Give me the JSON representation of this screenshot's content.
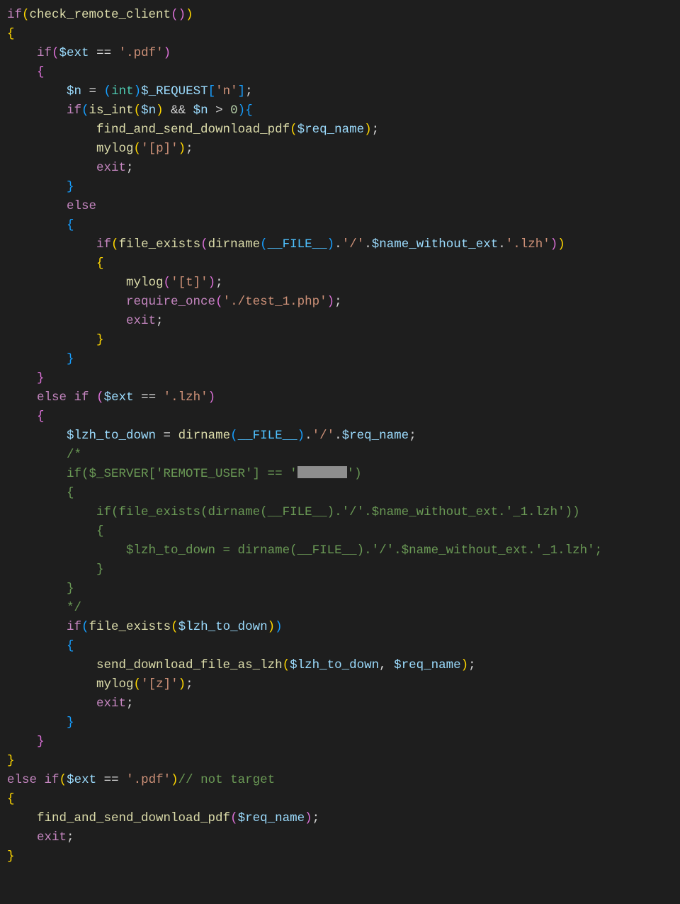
{
  "code": {
    "lines": [
      {
        "indent": 0,
        "seg": [
          {
            "c": "kw",
            "t": "if"
          },
          {
            "c": "br",
            "t": "("
          },
          {
            "c": "fn",
            "t": "check_remote_client"
          },
          {
            "c": "br2",
            "t": "("
          },
          {
            "c": "br2",
            "t": ")"
          },
          {
            "c": "br",
            "t": ")"
          }
        ]
      },
      {
        "indent": 0,
        "seg": [
          {
            "c": "br",
            "t": "{"
          }
        ]
      },
      {
        "indent": 1,
        "seg": [
          {
            "c": "kw",
            "t": "if"
          },
          {
            "c": "br2",
            "t": "("
          },
          {
            "c": "var",
            "t": "$ext"
          },
          {
            "c": "op",
            "t": " == "
          },
          {
            "c": "str",
            "t": "'.pdf'"
          },
          {
            "c": "br2",
            "t": ")"
          }
        ]
      },
      {
        "indent": 1,
        "seg": [
          {
            "c": "br2",
            "t": "{"
          }
        ]
      },
      {
        "indent": 2,
        "seg": [
          {
            "c": "var",
            "t": "$n"
          },
          {
            "c": "op",
            "t": " = "
          },
          {
            "c": "br3",
            "t": "("
          },
          {
            "c": "typ",
            "t": "int"
          },
          {
            "c": "br3",
            "t": ")"
          },
          {
            "c": "var",
            "t": "$_REQUEST"
          },
          {
            "c": "br3",
            "t": "["
          },
          {
            "c": "str",
            "t": "'n'"
          },
          {
            "c": "br3",
            "t": "]"
          },
          {
            "c": "op",
            "t": ";"
          }
        ]
      },
      {
        "indent": 2,
        "seg": [
          {
            "c": "kw",
            "t": "if"
          },
          {
            "c": "br3",
            "t": "("
          },
          {
            "c": "fn",
            "t": "is_int"
          },
          {
            "c": "br",
            "t": "("
          },
          {
            "c": "var",
            "t": "$n"
          },
          {
            "c": "br",
            "t": ")"
          },
          {
            "c": "op",
            "t": " && "
          },
          {
            "c": "var",
            "t": "$n"
          },
          {
            "c": "op",
            "t": " > "
          },
          {
            "c": "num",
            "t": "0"
          },
          {
            "c": "br3",
            "t": ")"
          },
          {
            "c": "br3",
            "t": "{"
          }
        ]
      },
      {
        "indent": 3,
        "seg": [
          {
            "c": "fn",
            "t": "find_and_send_download_pdf"
          },
          {
            "c": "br",
            "t": "("
          },
          {
            "c": "var",
            "t": "$req_name"
          },
          {
            "c": "br",
            "t": ")"
          },
          {
            "c": "op",
            "t": ";"
          }
        ]
      },
      {
        "indent": 3,
        "seg": [
          {
            "c": "fn",
            "t": "mylog"
          },
          {
            "c": "br",
            "t": "("
          },
          {
            "c": "str",
            "t": "'[p]'"
          },
          {
            "c": "br",
            "t": ")"
          },
          {
            "c": "op",
            "t": ";"
          }
        ]
      },
      {
        "indent": 3,
        "seg": [
          {
            "c": "kw",
            "t": "exit"
          },
          {
            "c": "op",
            "t": ";"
          }
        ]
      },
      {
        "indent": 2,
        "seg": [
          {
            "c": "br3",
            "t": "}"
          }
        ]
      },
      {
        "indent": 2,
        "seg": [
          {
            "c": "kw",
            "t": "else"
          }
        ]
      },
      {
        "indent": 2,
        "seg": [
          {
            "c": "br3",
            "t": "{"
          }
        ]
      },
      {
        "indent": 3,
        "seg": [
          {
            "c": "kw",
            "t": "if"
          },
          {
            "c": "br",
            "t": "("
          },
          {
            "c": "fn",
            "t": "file_exists"
          },
          {
            "c": "br2",
            "t": "("
          },
          {
            "c": "fn",
            "t": "dirname"
          },
          {
            "c": "br3",
            "t": "("
          },
          {
            "c": "cst",
            "t": "__FILE__"
          },
          {
            "c": "br3",
            "t": ")"
          },
          {
            "c": "op",
            "t": "."
          },
          {
            "c": "str",
            "t": "'/'"
          },
          {
            "c": "op",
            "t": "."
          },
          {
            "c": "var",
            "t": "$name_without_ext"
          },
          {
            "c": "op",
            "t": "."
          },
          {
            "c": "str",
            "t": "'.lzh'"
          },
          {
            "c": "br2",
            "t": ")"
          },
          {
            "c": "br",
            "t": ")"
          }
        ]
      },
      {
        "indent": 3,
        "seg": [
          {
            "c": "br",
            "t": "{"
          }
        ]
      },
      {
        "indent": 4,
        "seg": [
          {
            "c": "fn",
            "t": "mylog"
          },
          {
            "c": "br2",
            "t": "("
          },
          {
            "c": "str",
            "t": "'[t]'"
          },
          {
            "c": "br2",
            "t": ")"
          },
          {
            "c": "op",
            "t": ";"
          }
        ]
      },
      {
        "indent": 4,
        "seg": [
          {
            "c": "kw",
            "t": "require_once"
          },
          {
            "c": "br2",
            "t": "("
          },
          {
            "c": "str",
            "t": "'./test_1.php'"
          },
          {
            "c": "br2",
            "t": ")"
          },
          {
            "c": "op",
            "t": ";"
          }
        ]
      },
      {
        "indent": 4,
        "seg": [
          {
            "c": "kw",
            "t": "exit"
          },
          {
            "c": "op",
            "t": ";"
          }
        ]
      },
      {
        "indent": 3,
        "seg": [
          {
            "c": "br",
            "t": "}"
          }
        ]
      },
      {
        "indent": 2,
        "seg": [
          {
            "c": "br3",
            "t": "}"
          }
        ]
      },
      {
        "indent": 1,
        "seg": [
          {
            "c": "br2",
            "t": "}"
          }
        ]
      },
      {
        "indent": 1,
        "seg": [
          {
            "c": "kw",
            "t": "else"
          },
          {
            "c": "op",
            "t": " "
          },
          {
            "c": "kw",
            "t": "if"
          },
          {
            "c": "op",
            "t": " "
          },
          {
            "c": "br2",
            "t": "("
          },
          {
            "c": "var",
            "t": "$ext"
          },
          {
            "c": "op",
            "t": " == "
          },
          {
            "c": "str",
            "t": "'.lzh'"
          },
          {
            "c": "br2",
            "t": ")"
          }
        ]
      },
      {
        "indent": 1,
        "seg": [
          {
            "c": "br2",
            "t": "{"
          }
        ]
      },
      {
        "indent": 2,
        "seg": [
          {
            "c": "var",
            "t": "$lzh_to_down"
          },
          {
            "c": "op",
            "t": " = "
          },
          {
            "c": "fn",
            "t": "dirname"
          },
          {
            "c": "br3",
            "t": "("
          },
          {
            "c": "cst",
            "t": "__FILE__"
          },
          {
            "c": "br3",
            "t": ")"
          },
          {
            "c": "op",
            "t": "."
          },
          {
            "c": "str",
            "t": "'/'"
          },
          {
            "c": "op",
            "t": "."
          },
          {
            "c": "var",
            "t": "$req_name"
          },
          {
            "c": "op",
            "t": ";"
          }
        ]
      },
      {
        "indent": 2,
        "seg": [
          {
            "c": "cmt",
            "t": "/*"
          }
        ]
      },
      {
        "indent": 2,
        "seg": [
          {
            "c": "cmt",
            "t": "if($_SERVER['REMOTE_USER'] == '"
          },
          {
            "c": "redact",
            "t": ""
          },
          {
            "c": "cmt",
            "t": "')"
          }
        ]
      },
      {
        "indent": 2,
        "seg": [
          {
            "c": "cmt",
            "t": "{"
          }
        ]
      },
      {
        "indent": 3,
        "seg": [
          {
            "c": "cmt",
            "t": "if(file_exists(dirname(__FILE__).'/'.$name_without_ext.'_1.lzh'))"
          }
        ]
      },
      {
        "indent": 3,
        "seg": [
          {
            "c": "cmt",
            "t": "{"
          }
        ]
      },
      {
        "indent": 4,
        "seg": [
          {
            "c": "cmt",
            "t": "$lzh_to_down = dirname(__FILE__).'/'.$name_without_ext.'_1.lzh';"
          }
        ]
      },
      {
        "indent": 3,
        "seg": [
          {
            "c": "cmt",
            "t": "}"
          }
        ]
      },
      {
        "indent": 2,
        "seg": [
          {
            "c": "cmt",
            "t": "}"
          }
        ]
      },
      {
        "indent": 2,
        "seg": [
          {
            "c": "cmt",
            "t": "*/"
          }
        ]
      },
      {
        "indent": 2,
        "seg": [
          {
            "c": "kw",
            "t": "if"
          },
          {
            "c": "br3",
            "t": "("
          },
          {
            "c": "fn",
            "t": "file_exists"
          },
          {
            "c": "br",
            "t": "("
          },
          {
            "c": "var",
            "t": "$lzh_to_down"
          },
          {
            "c": "br",
            "t": ")"
          },
          {
            "c": "br3",
            "t": ")"
          }
        ]
      },
      {
        "indent": 2,
        "seg": [
          {
            "c": "br3",
            "t": "{"
          }
        ]
      },
      {
        "indent": 3,
        "seg": [
          {
            "c": "fn",
            "t": "send_download_file_as_lzh"
          },
          {
            "c": "br",
            "t": "("
          },
          {
            "c": "var",
            "t": "$lzh_to_down"
          },
          {
            "c": "op",
            "t": ", "
          },
          {
            "c": "var",
            "t": "$req_name"
          },
          {
            "c": "br",
            "t": ")"
          },
          {
            "c": "op",
            "t": ";"
          }
        ]
      },
      {
        "indent": 3,
        "seg": [
          {
            "c": "fn",
            "t": "mylog"
          },
          {
            "c": "br",
            "t": "("
          },
          {
            "c": "str",
            "t": "'[z]'"
          },
          {
            "c": "br",
            "t": ")"
          },
          {
            "c": "op",
            "t": ";"
          }
        ]
      },
      {
        "indent": 3,
        "seg": [
          {
            "c": "kw",
            "t": "exit"
          },
          {
            "c": "op",
            "t": ";"
          }
        ]
      },
      {
        "indent": 2,
        "seg": [
          {
            "c": "br3",
            "t": "}"
          }
        ]
      },
      {
        "indent": 1,
        "seg": [
          {
            "c": "br2",
            "t": "}"
          }
        ]
      },
      {
        "indent": 0,
        "seg": [
          {
            "c": "br",
            "t": "}"
          }
        ]
      },
      {
        "indent": 0,
        "seg": [
          {
            "c": "kw",
            "t": "else"
          },
          {
            "c": "op",
            "t": " "
          },
          {
            "c": "kw",
            "t": "if"
          },
          {
            "c": "br",
            "t": "("
          },
          {
            "c": "var",
            "t": "$ext"
          },
          {
            "c": "op",
            "t": " == "
          },
          {
            "c": "str",
            "t": "'.pdf'"
          },
          {
            "c": "br",
            "t": ")"
          },
          {
            "c": "cmt",
            "t": "// not target"
          }
        ]
      },
      {
        "indent": 0,
        "seg": [
          {
            "c": "br",
            "t": "{"
          }
        ]
      },
      {
        "indent": 1,
        "seg": [
          {
            "c": "fn",
            "t": "find_and_send_download_pdf"
          },
          {
            "c": "br2",
            "t": "("
          },
          {
            "c": "var",
            "t": "$req_name"
          },
          {
            "c": "br2",
            "t": ")"
          },
          {
            "c": "op",
            "t": ";"
          }
        ]
      },
      {
        "indent": 1,
        "seg": [
          {
            "c": "kw",
            "t": "exit"
          },
          {
            "c": "op",
            "t": ";"
          }
        ]
      },
      {
        "indent": 0,
        "seg": [
          {
            "c": "br",
            "t": "}"
          }
        ]
      }
    ]
  }
}
